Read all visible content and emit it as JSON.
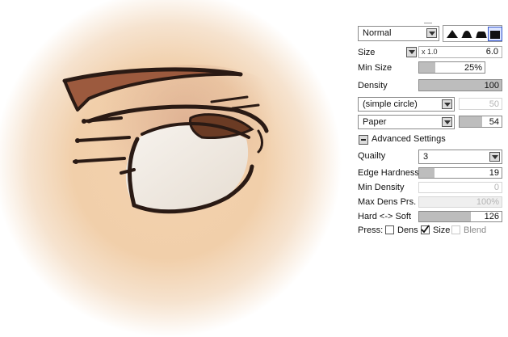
{
  "blend_mode": {
    "value": "Normal"
  },
  "brush_shapes": [
    {
      "name": "sharp-shape-icon",
      "selected": false
    },
    {
      "name": "round-shape-icon",
      "selected": false
    },
    {
      "name": "flat-shape-icon",
      "selected": false
    },
    {
      "name": "hard-shape-icon",
      "selected": true
    }
  ],
  "size": {
    "label": "Size",
    "multiplier": "x 1.0",
    "value": "6.0"
  },
  "min_size": {
    "label": "Min Size",
    "value": "25%",
    "level": 0.25
  },
  "density": {
    "label": "Density",
    "value": "100",
    "level": 1.0
  },
  "brush_texture": {
    "value": "(simple circle)",
    "strength": "50",
    "enabled": false
  },
  "paper_texture": {
    "value": "Paper",
    "strength": "54",
    "level": 0.54
  },
  "advanced": {
    "title": "Advanced Settings",
    "quality": {
      "label": "Quailty",
      "value": "3"
    },
    "edge_hardness": {
      "label": "Edge Hardness",
      "value": "19",
      "level": 0.19
    },
    "min_density": {
      "label": "Min Density",
      "value": "0",
      "level": 0.0
    },
    "max_dens_prs": {
      "label": "Max Dens Prs.",
      "value": "100%",
      "level": 1.0
    },
    "hard_soft": {
      "label": "Hard <-> Soft",
      "value": "126",
      "level": 0.63
    },
    "press": {
      "label": "Press:",
      "dens": {
        "label": "Dens",
        "checked": false
      },
      "size": {
        "label": "Size",
        "checked": true
      },
      "blend": {
        "label": "Blend",
        "checked": false
      }
    }
  },
  "colors": {
    "skin_center": "#f3d1ae",
    "skin_edge": "#ffffff",
    "lash": "#2a1a14",
    "iris": "#6b3b24",
    "eyeshadow": "#9c5a3e",
    "eye_white": "#f2ede6",
    "slider_fill": "#bdbdbd"
  }
}
